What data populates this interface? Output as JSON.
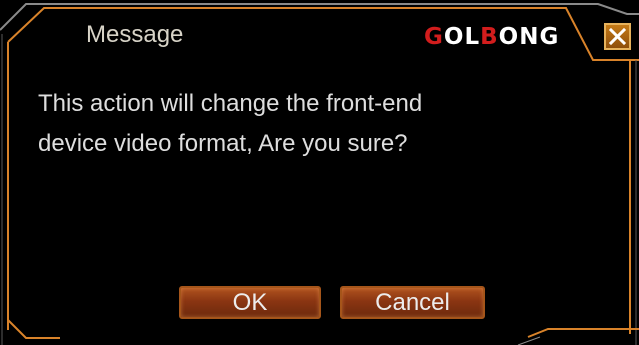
{
  "dialog": {
    "title": "Message",
    "brand": {
      "part1": "G",
      "part2": "OL",
      "part3": "B",
      "part4": "ONG"
    },
    "close_icon": "close-icon",
    "message_line1": "This action will change the front-end",
    "message_line2": "device video format, Are you sure?",
    "ok_label": "OK",
    "cancel_label": "Cancel"
  },
  "colors": {
    "background": "#000000",
    "frame_orange": "#d9832a",
    "frame_grey": "#8a8a8a",
    "brand_red": "#d21d1d",
    "button_fill": "#8a3512",
    "text": "#dedede"
  }
}
